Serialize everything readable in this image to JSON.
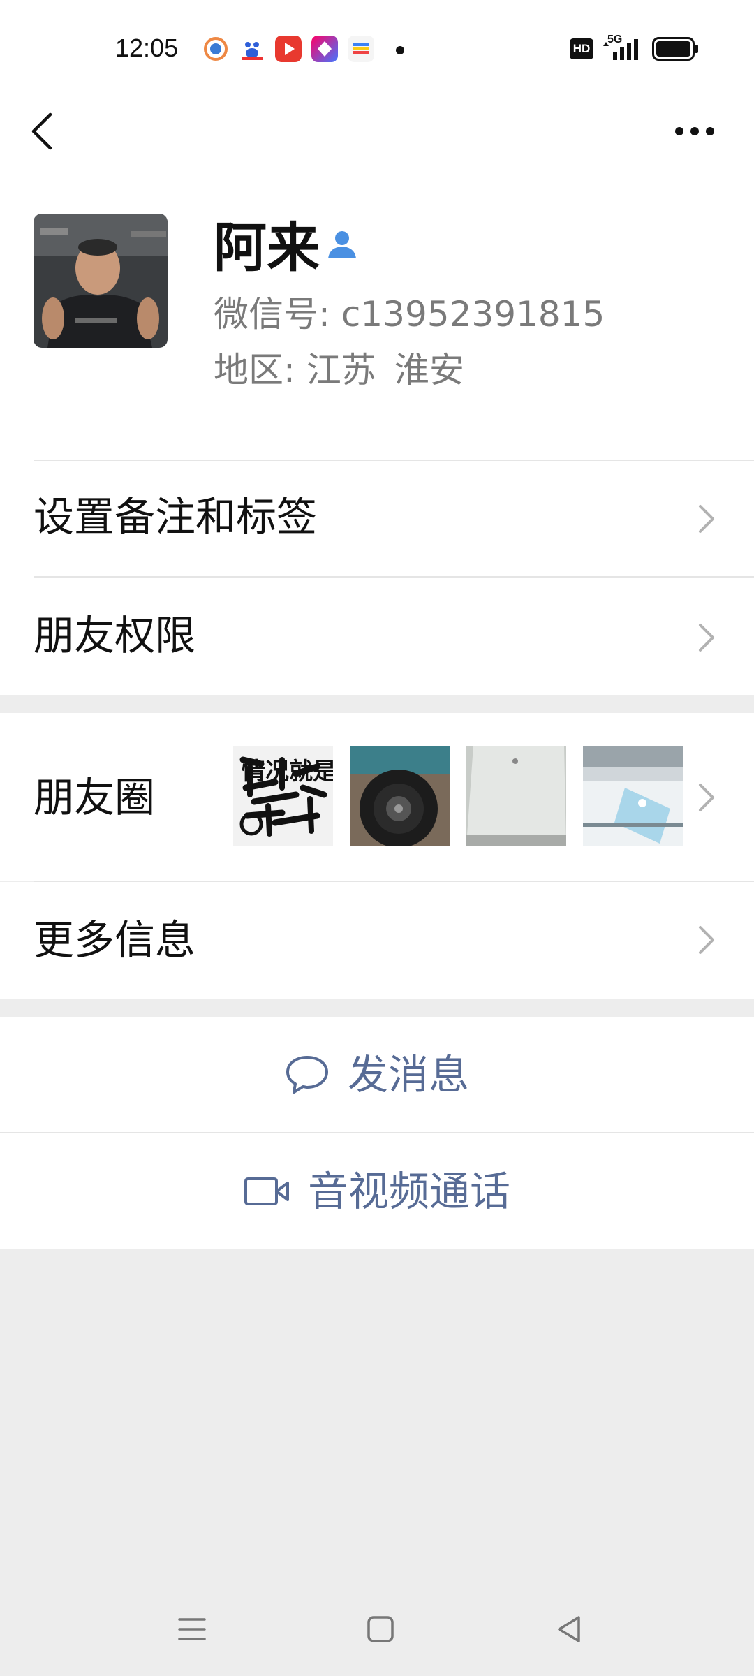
{
  "status_bar": {
    "time": "12:05",
    "hd_badge": "HD",
    "network": "5G"
  },
  "profile": {
    "name": "阿来",
    "wechat_id_label": "微信号:",
    "wechat_id": "c13952391815",
    "region_label": "地区:",
    "region_province": "江苏",
    "region_city": "淮安"
  },
  "menu": {
    "remark_tags": "设置备注和标签",
    "friend_permissions": "朋友权限",
    "moments": "朋友圈",
    "more_info": "更多信息"
  },
  "moments_thumbs": [
    {
      "text": "情况就是这么个情况"
    },
    {
      "text": ""
    },
    {
      "text": ""
    },
    {
      "text": ""
    }
  ],
  "actions": {
    "send_message": "发消息",
    "av_call": "音视频通话"
  },
  "colors": {
    "accent": "#576b95",
    "page_bg": "#ededed",
    "verify_blue": "#4a90e2"
  }
}
